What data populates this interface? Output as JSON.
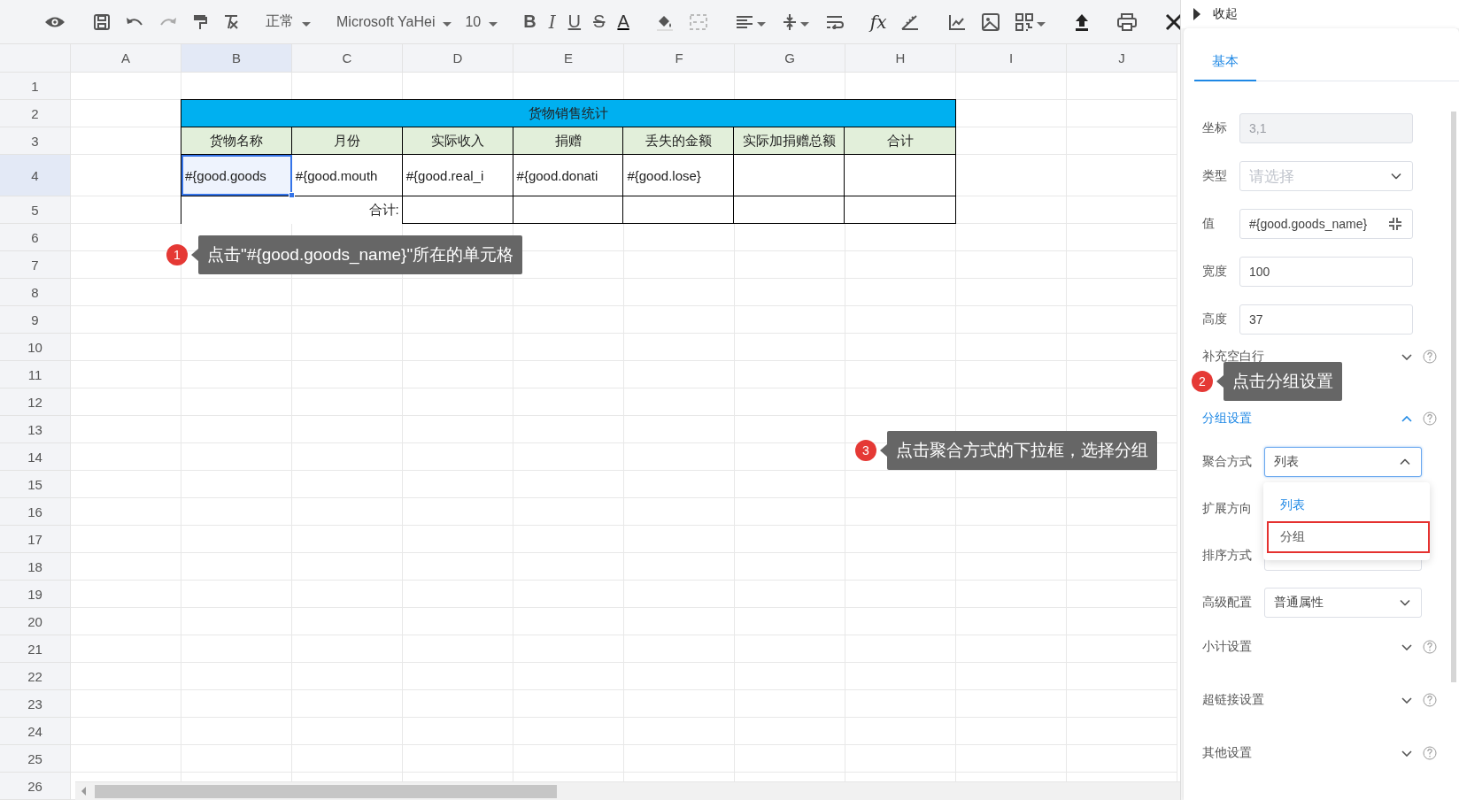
{
  "toolbar": {
    "dropdowns": [
      "正常",
      "Microsoft YaHei",
      "10"
    ],
    "glyph_buttons": [
      "B",
      "I",
      "U",
      "S",
      "A",
      "fx"
    ]
  },
  "sheet": {
    "columns": [
      {
        "label": "A",
        "selected": false
      },
      {
        "label": "B",
        "selected": true
      },
      {
        "label": "C",
        "selected": false
      },
      {
        "label": "D",
        "selected": false
      },
      {
        "label": "E",
        "selected": false
      },
      {
        "label": "F",
        "selected": false
      },
      {
        "label": "G",
        "selected": false
      },
      {
        "label": "H",
        "selected": false
      },
      {
        "label": "I",
        "selected": false
      },
      {
        "label": "J",
        "selected": false
      }
    ],
    "rows": [
      {
        "label": "1",
        "selected": false
      },
      {
        "label": "2",
        "selected": false
      },
      {
        "label": "3",
        "selected": false
      },
      {
        "label": "4",
        "selected": true
      },
      {
        "label": "5",
        "selected": false
      },
      {
        "label": "6",
        "selected": false
      },
      {
        "label": "7",
        "selected": false
      },
      {
        "label": "8",
        "selected": false
      },
      {
        "label": "9",
        "selected": false
      },
      {
        "label": "10",
        "selected": false
      },
      {
        "label": "11",
        "selected": false
      },
      {
        "label": "12",
        "selected": false
      },
      {
        "label": "13",
        "selected": false
      },
      {
        "label": "14",
        "selected": false
      },
      {
        "label": "15",
        "selected": false
      },
      {
        "label": "16",
        "selected": false
      },
      {
        "label": "17",
        "selected": false
      },
      {
        "label": "18",
        "selected": false
      },
      {
        "label": "19",
        "selected": false
      },
      {
        "label": "20",
        "selected": false
      },
      {
        "label": "21",
        "selected": false
      },
      {
        "label": "22",
        "selected": false
      },
      {
        "label": "23",
        "selected": false
      },
      {
        "label": "24",
        "selected": false
      },
      {
        "label": "25",
        "selected": false
      },
      {
        "label": "26",
        "selected": false
      }
    ],
    "report": {
      "title": "货物销售统计",
      "headers": [
        "货物名称",
        "月份",
        "实际收入",
        "捐赠",
        "丢失的金额",
        "实际加捐赠总额",
        "合计"
      ],
      "data_row": [
        {
          "text": "#{good.goods",
          "selected": true
        },
        {
          "text": "#{good.mouth",
          "selected": false
        },
        {
          "text": "#{good.real_i",
          "selected": false
        },
        {
          "text": "#{good.donati",
          "selected": false
        },
        {
          "text": "#{good.lose}",
          "selected": false
        }
      ],
      "total_label": "合计:"
    }
  },
  "panel": {
    "collapse_label": "收起",
    "tabs": [
      {
        "label": "基本",
        "selected": true
      }
    ],
    "fields": [
      {
        "label": "坐标",
        "kind": "input",
        "value": "3,1",
        "disabled": true
      },
      {
        "label": "类型",
        "kind": "select",
        "placeholder": "请选择"
      },
      {
        "label": "值",
        "kind": "expand-input",
        "value": "#{good.goods_name}"
      },
      {
        "label": "宽度",
        "kind": "input",
        "value": "100",
        "disabled": false
      },
      {
        "label": "高度",
        "kind": "input",
        "value": "37",
        "disabled": false
      }
    ],
    "sections": [
      {
        "title": "补充空白行",
        "expanded": false
      },
      {
        "title": "分组设置",
        "expanded": true,
        "fields": [
          {
            "label": "聚合方式",
            "kind": "select",
            "value": "列表",
            "open": true,
            "options": [
              {
                "label": "列表",
                "selected": true,
                "highlighted": false
              },
              {
                "label": "分组",
                "selected": false,
                "highlighted": true
              }
            ]
          },
          {
            "label": "扩展方向"
          },
          {
            "label": "排序方式",
            "kind": "select"
          },
          {
            "label": "高级配置",
            "kind": "select",
            "value": "普通属性"
          }
        ]
      },
      {
        "title": "小计设置",
        "expanded": false
      },
      {
        "title": "超链接设置",
        "expanded": false
      },
      {
        "title": "其他设置",
        "expanded": false
      }
    ]
  },
  "annotations": [
    {
      "number": "1",
      "text": "点击\"#{good.goods_name}\"所在的单元格"
    },
    {
      "number": "2",
      "text": "点击分组设置"
    },
    {
      "number": "3",
      "text": "点击聚合方式的下拉框，选择分组"
    }
  ]
}
